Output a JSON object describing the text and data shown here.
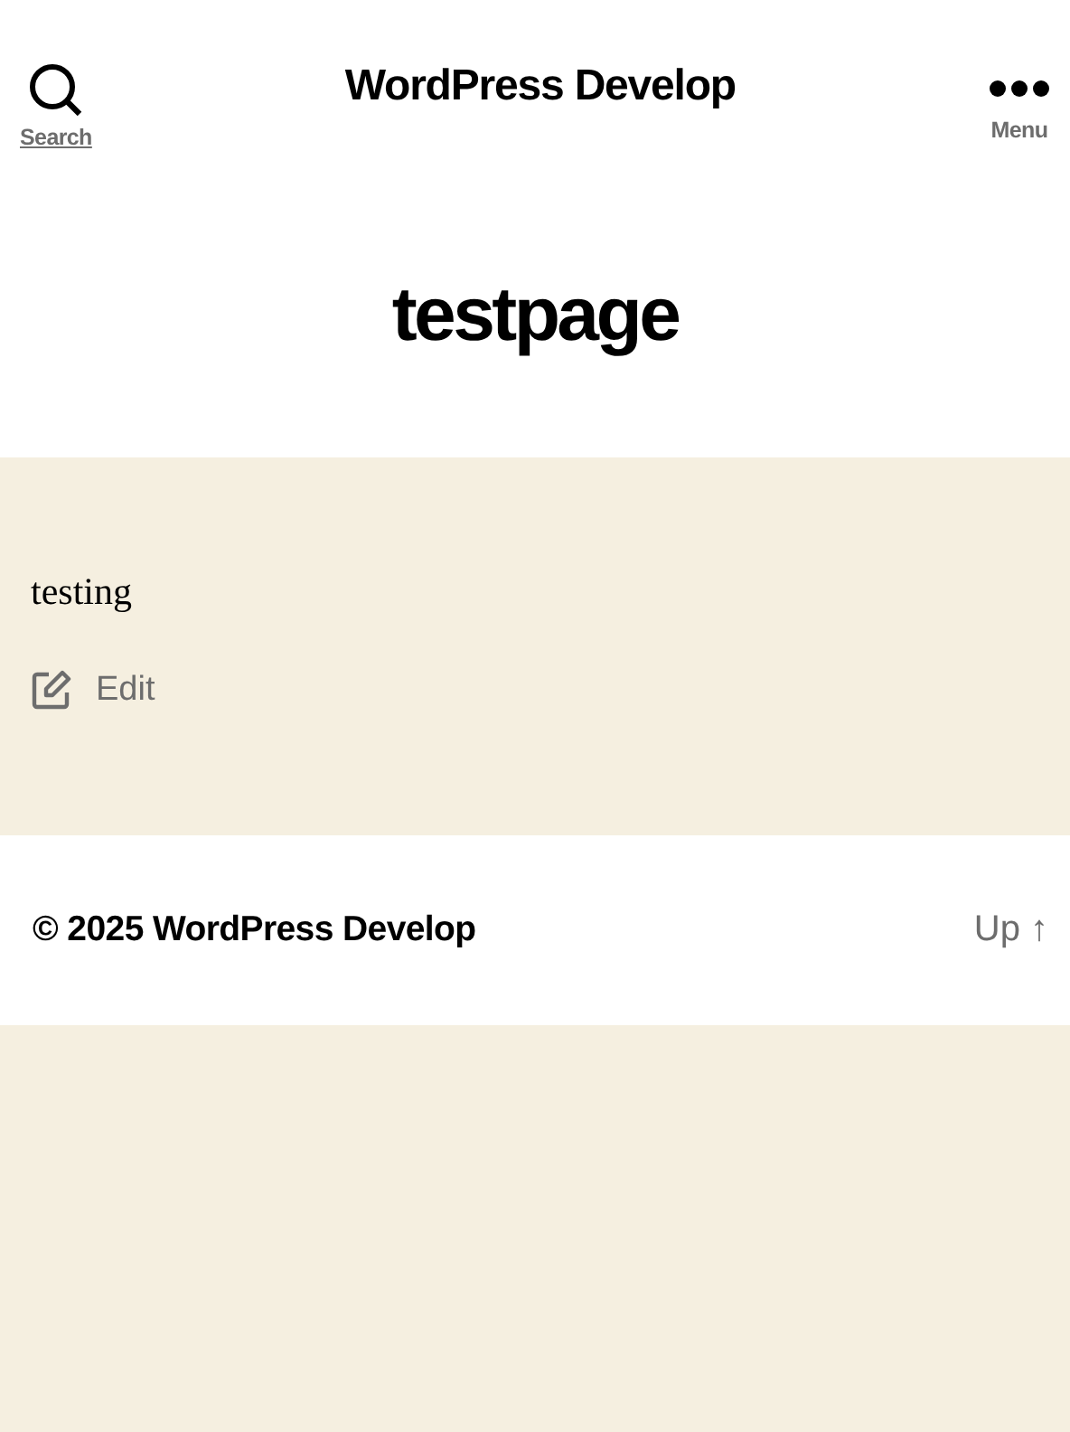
{
  "header": {
    "search_label": "Search",
    "site_title": "WordPress Develop",
    "menu_label": "Menu"
  },
  "page": {
    "title": "testpage",
    "content": "testing",
    "edit_label": "Edit"
  },
  "footer": {
    "copyright": "© 2025 WordPress Develop",
    "up_link": "Up ↑"
  }
}
